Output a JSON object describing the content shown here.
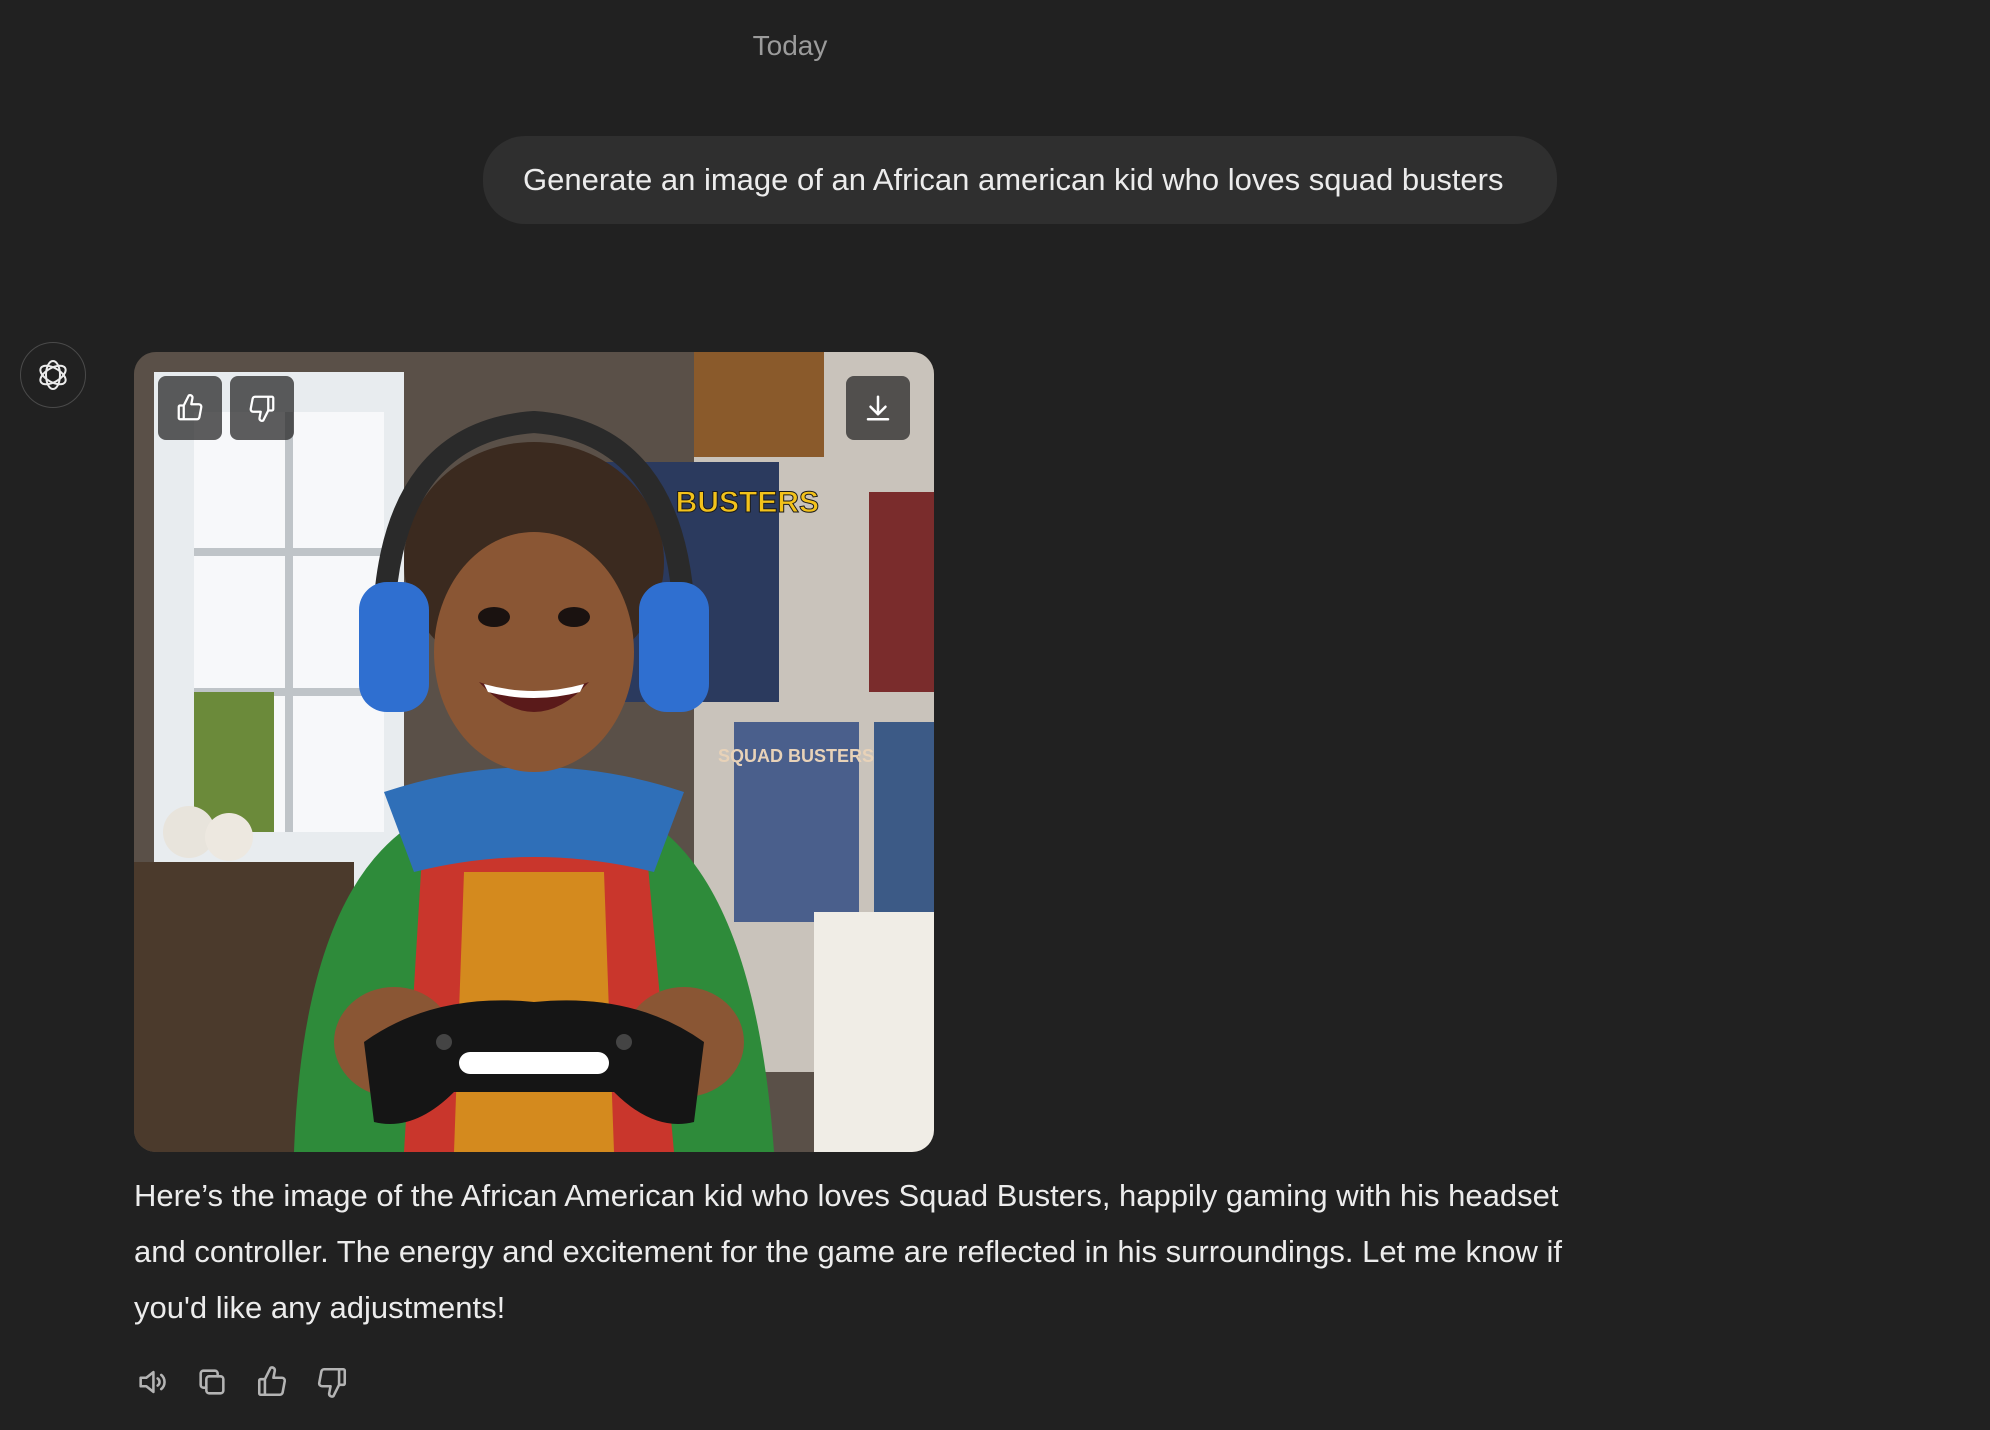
{
  "conversation": {
    "date_label": "Today",
    "user_message": "Generate an image of an African american kid who loves squad busters",
    "assistant_message": "Here’s the image of the African American kid who loves Squad Busters, happily gaming with his headset and controller. The energy and excitement for the game are reflected in his surroundings. Let me know if you'd like any adjustments!"
  },
  "image": {
    "poster_text_1": "SQUAD BUSTERS",
    "poster_text_2": "SQUAD BUSTERS",
    "overlay_buttons": [
      "thumbs-up-icon",
      "thumbs-down-icon",
      "download-icon"
    ]
  },
  "actions": [
    "read-aloud-icon",
    "copy-icon",
    "thumbs-up-icon",
    "thumbs-down-icon"
  ],
  "colors": {
    "background": "#212121",
    "bubble": "#2f2f2f",
    "text": "#ececec",
    "muted": "#9b9b9b"
  }
}
